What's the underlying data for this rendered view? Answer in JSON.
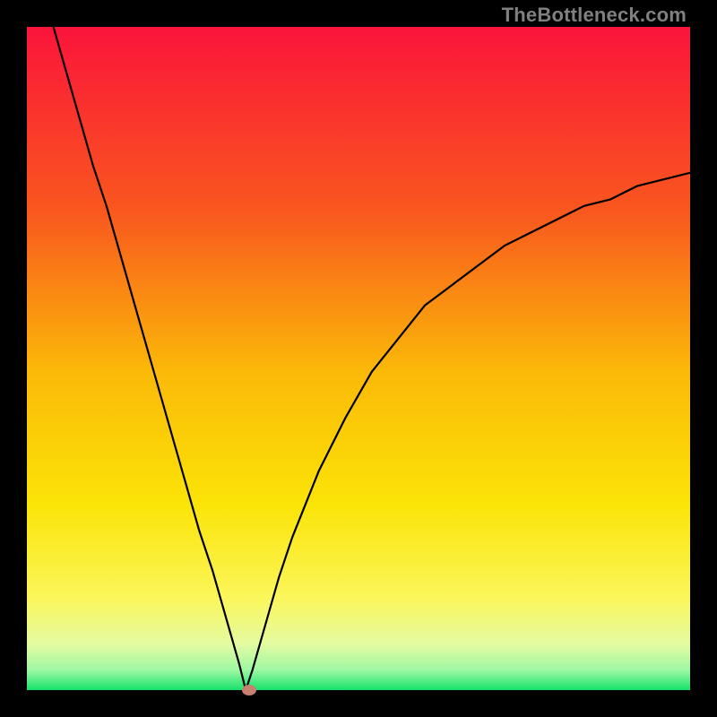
{
  "watermark": "TheBottleneck.com",
  "colors": {
    "top": "#fb143a",
    "upper_mid": "#f97c1e",
    "mid": "#fbd407",
    "lower_mid": "#fbf65a",
    "low": "#e7fba1",
    "bottom": "#16e06a",
    "frame": "#000000",
    "curve": "#000000",
    "marker": "#c67f71"
  },
  "chart_data": {
    "type": "line",
    "title": "",
    "xlabel": "",
    "ylabel": "",
    "xlim": [
      0,
      100
    ],
    "ylim": [
      0,
      100
    ],
    "x_min_point": 33,
    "annotations": [
      {
        "name": "marker",
        "x": 33.5,
        "y": 0,
        "color": "#c67f71"
      }
    ],
    "series": [
      {
        "name": "bottleneck-curve",
        "x": [
          4,
          6,
          8,
          10,
          12,
          14,
          16,
          18,
          20,
          22,
          24,
          26,
          28,
          30,
          32,
          33,
          34,
          36,
          38,
          40,
          44,
          48,
          52,
          56,
          60,
          64,
          68,
          72,
          76,
          80,
          84,
          88,
          92,
          96,
          100
        ],
        "y": [
          100,
          93,
          86,
          79,
          73,
          66,
          59,
          52,
          45,
          38,
          31,
          24,
          18,
          11,
          4,
          0,
          3,
          10,
          17,
          23,
          33,
          41,
          48,
          53,
          58,
          61,
          64,
          67,
          69,
          71,
          73,
          74,
          76,
          77,
          78
        ]
      }
    ]
  }
}
